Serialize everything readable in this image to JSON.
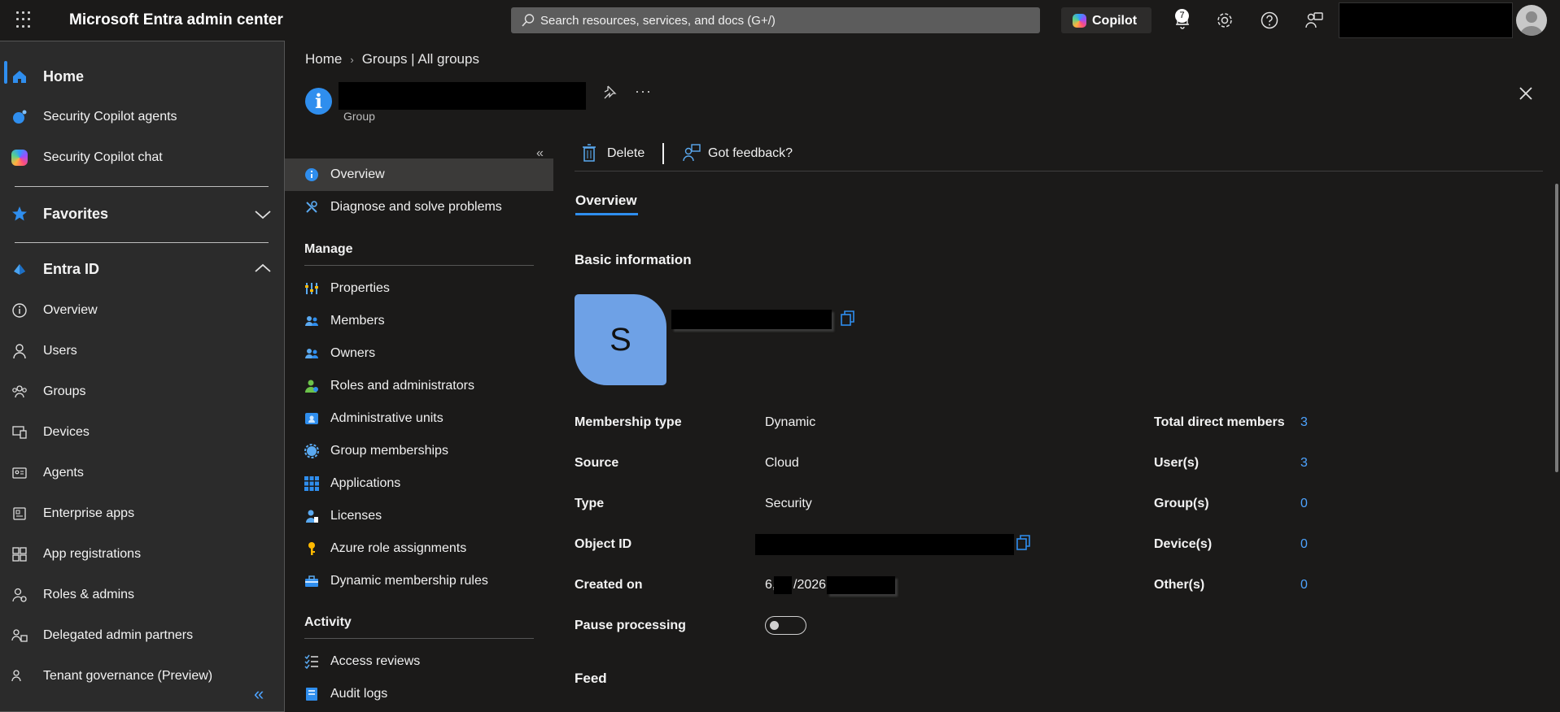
{
  "topbar": {
    "title": "Microsoft Entra admin center",
    "search_placeholder": "Search resources, services, and docs (G+/)",
    "copilot_label": "Copilot",
    "notification_count": "7"
  },
  "leftnav": {
    "items": [
      {
        "label": "Home"
      },
      {
        "label": "Security Copilot agents"
      },
      {
        "label": "Security Copilot chat"
      },
      {
        "label": "Favorites"
      },
      {
        "label": "Entra ID"
      },
      {
        "label": "Overview"
      },
      {
        "label": "Users"
      },
      {
        "label": "Groups"
      },
      {
        "label": "Devices"
      },
      {
        "label": "Agents"
      },
      {
        "label": "Enterprise apps"
      },
      {
        "label": "App registrations"
      },
      {
        "label": "Roles & admins"
      },
      {
        "label": "Delegated admin partners"
      },
      {
        "label": "Tenant governance (Preview)"
      }
    ],
    "collapse_glyph": "«"
  },
  "header": {
    "breadcrumb": [
      "Home",
      "Groups | All groups"
    ],
    "subtitle": "Group",
    "more": "···"
  },
  "resource_menu": {
    "collapse_glyph": "«",
    "top_items": [
      {
        "label": "Overview"
      },
      {
        "label": "Diagnose and solve problems"
      }
    ],
    "manage_heading": "Manage",
    "manage_items": [
      {
        "label": "Properties"
      },
      {
        "label": "Members"
      },
      {
        "label": "Owners"
      },
      {
        "label": "Roles and administrators"
      },
      {
        "label": "Administrative units"
      },
      {
        "label": "Group memberships"
      },
      {
        "label": "Applications"
      },
      {
        "label": "Licenses"
      },
      {
        "label": "Azure role assignments"
      },
      {
        "label": "Dynamic membership rules"
      }
    ],
    "activity_heading": "Activity",
    "activity_items": [
      {
        "label": "Access reviews"
      },
      {
        "label": "Audit logs"
      }
    ]
  },
  "commands": {
    "delete": "Delete",
    "feedback": "Got feedback?"
  },
  "overview": {
    "tab": "Overview",
    "basic_title": "Basic information",
    "avatar_letter": "S",
    "feed_title": "Feed",
    "left_props": [
      {
        "label": "Membership type",
        "value": "Dynamic"
      },
      {
        "label": "Source",
        "value": "Cloud"
      },
      {
        "label": "Type",
        "value": "Security"
      },
      {
        "label": "Object ID",
        "value": ""
      },
      {
        "label": "Created on",
        "value_a": "6,",
        "value_b": "/2026"
      },
      {
        "label": "Pause processing",
        "value": ""
      }
    ],
    "pause_processing_on": false,
    "right_props": [
      {
        "label": "Total direct members",
        "value": "3"
      },
      {
        "label": "User(s)",
        "value": "3"
      },
      {
        "label": "Group(s)",
        "value": "0"
      },
      {
        "label": "Device(s)",
        "value": "0"
      },
      {
        "label": "Other(s)",
        "value": "0"
      }
    ]
  },
  "colors": {
    "accent": "#2f8eee",
    "link": "#4da3ff",
    "background": "#1b1a19",
    "nav_background": "#2b2b2b"
  }
}
